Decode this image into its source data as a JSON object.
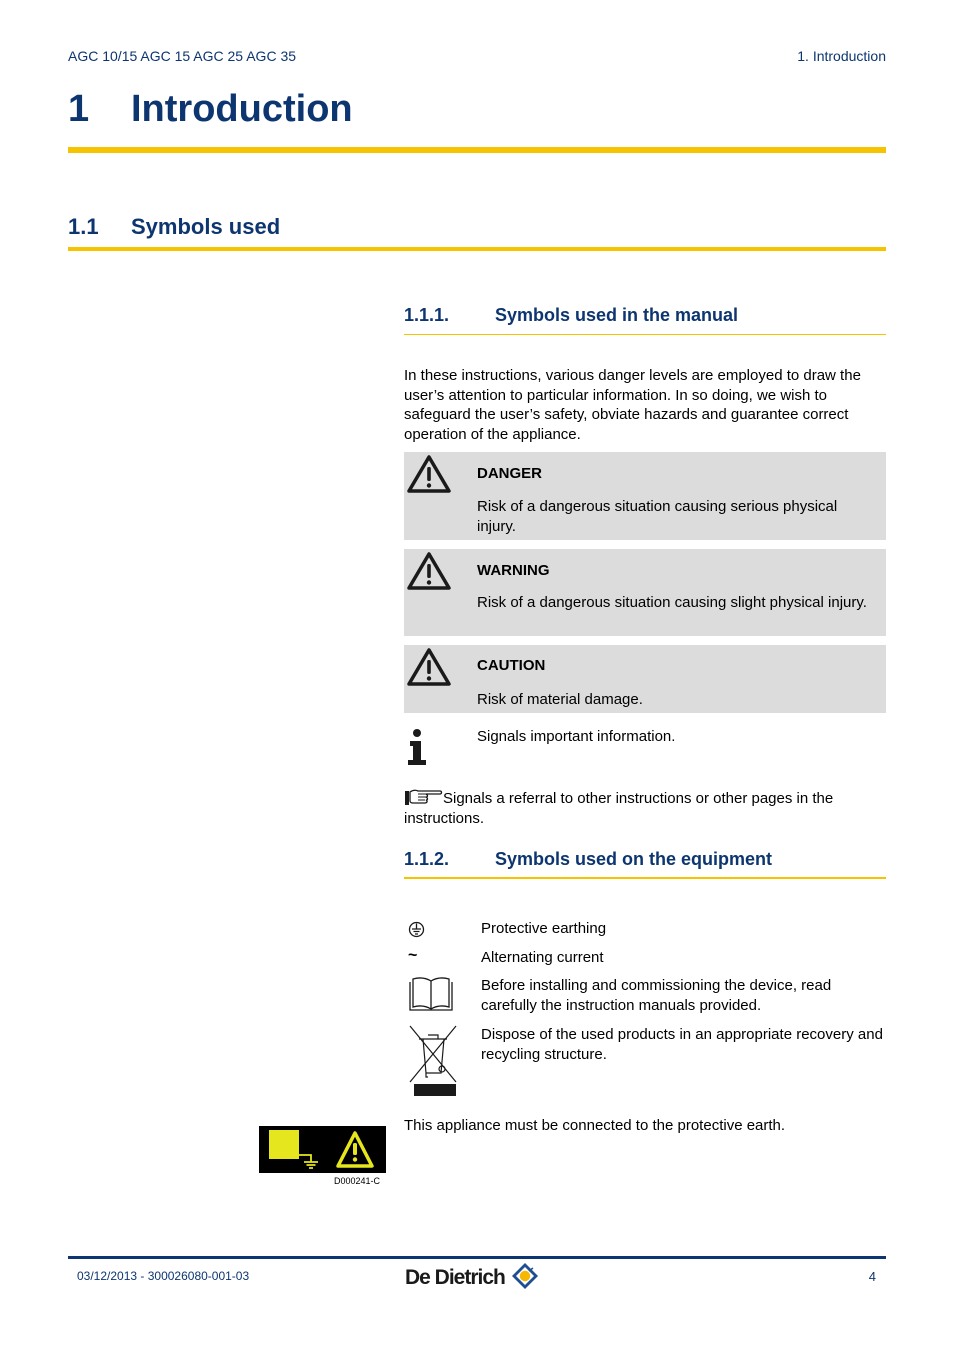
{
  "header": {
    "left": "AGC 10/15 AGC 15 AGC 25 AGC 35",
    "right": "1.  Introduction"
  },
  "chapter": {
    "number": "1",
    "title": "Introduction"
  },
  "section": {
    "number": "1.1",
    "title": "Symbols used"
  },
  "subsection_manual": {
    "number": "1.1.1.",
    "title": "Symbols used in the manual",
    "intro": "In these instructions, various danger levels are employed to draw the user’s attention to particular information. In so doing, we wish to safeguard the user’s safety, obviate hazards and guarantee correct operation of the appliance.",
    "notices": [
      {
        "icon": "warning-triangle-icon",
        "title": "DANGER",
        "text": "Risk of a dangerous situation causing serious physical injury."
      },
      {
        "icon": "warning-triangle-icon",
        "title": "WARNING",
        "text": "Risk of a dangerous situation causing slight physical injury."
      },
      {
        "icon": "warning-triangle-icon",
        "title": "CAUTION",
        "text": "Risk of material damage."
      }
    ],
    "info": {
      "icon": "info-icon",
      "text": "Signals important information."
    },
    "referral": {
      "icon": "pointing-hand-icon",
      "text": "Signals a referral to other instructions or other pages in the instructions."
    }
  },
  "subsection_equipment": {
    "number": "1.1.2.",
    "title": "Symbols used on the equipment",
    "symbols": [
      {
        "icon": "protective-earth-icon",
        "glyph": "⏚",
        "text": "Protective earthing"
      },
      {
        "icon": "alternating-current-icon",
        "glyph": "~",
        "text": "Alternating current"
      },
      {
        "icon": "manual-book-icon",
        "text": "Before installing and commissioning the device, read carefully the instruction manuals provided."
      },
      {
        "icon": "weee-crossed-bin-icon",
        "text": "Dispose of the used products in an appropriate recovery and recycling structure."
      }
    ],
    "earth_note": "This appliance must be connected to the protective earth.",
    "figure_caption": "D000241-C"
  },
  "footer": {
    "date_ref": "03/12/2013 - 300026080-001-03",
    "brand": "De Dietrich",
    "page": "4"
  },
  "colors": {
    "heading_navy": "#0d3570",
    "accent_yellow": "#f6c300",
    "notice_grey": "#dcdcdc",
    "label_yellow": "#e6e61e"
  }
}
